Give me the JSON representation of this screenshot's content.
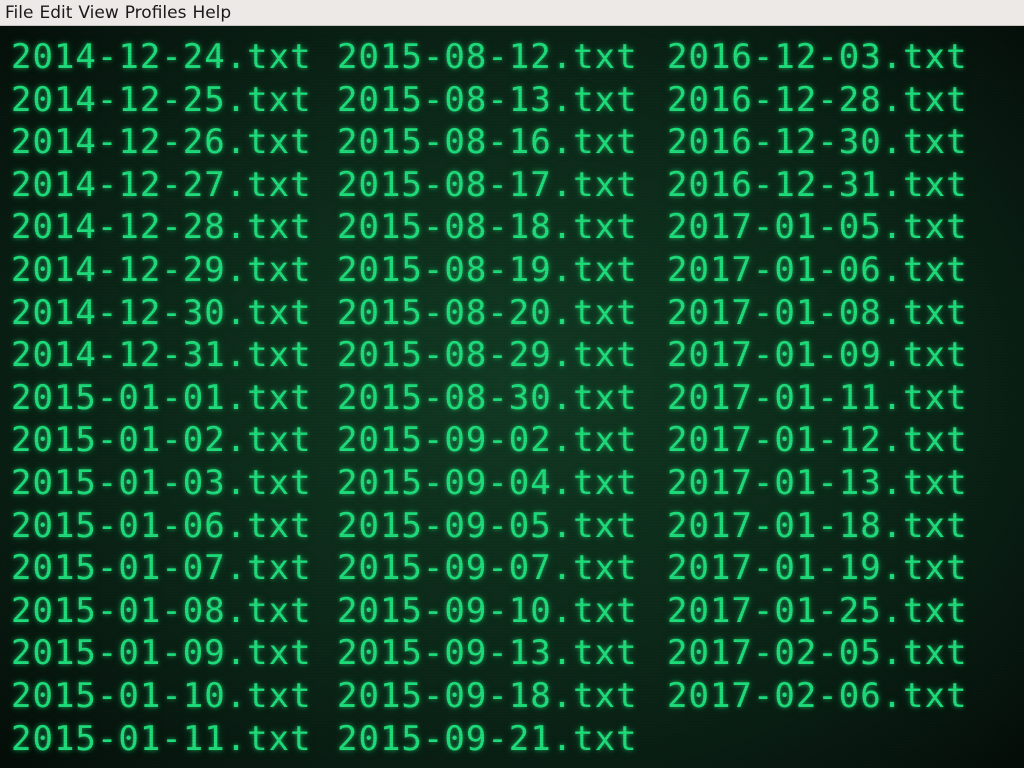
{
  "menubar": {
    "items": [
      {
        "label": "File"
      },
      {
        "label": "Edit"
      },
      {
        "label": "View"
      },
      {
        "label": "Profiles"
      },
      {
        "label": "Help"
      }
    ]
  },
  "terminal": {
    "text_color": "#1fdc7a",
    "background_color": "#0e2e1c",
    "columns": [
      {
        "files": [
          "2014-12-24.txt",
          "2014-12-25.txt",
          "2014-12-26.txt",
          "2014-12-27.txt",
          "2014-12-28.txt",
          "2014-12-29.txt",
          "2014-12-30.txt",
          "2014-12-31.txt",
          "2015-01-01.txt",
          "2015-01-02.txt",
          "2015-01-03.txt",
          "2015-01-06.txt",
          "2015-01-07.txt",
          "2015-01-08.txt",
          "2015-01-09.txt",
          "2015-01-10.txt",
          "2015-01-11.txt"
        ]
      },
      {
        "files": [
          "2015-08-12.txt",
          "2015-08-13.txt",
          "2015-08-16.txt",
          "2015-08-17.txt",
          "2015-08-18.txt",
          "2015-08-19.txt",
          "2015-08-20.txt",
          "2015-08-29.txt",
          "2015-08-30.txt",
          "2015-09-02.txt",
          "2015-09-04.txt",
          "2015-09-05.txt",
          "2015-09-07.txt",
          "2015-09-10.txt",
          "2015-09-13.txt",
          "2015-09-18.txt",
          "2015-09-21.txt"
        ]
      },
      {
        "files": [
          "2016-12-03.txt",
          "2016-12-28.txt",
          "2016-12-30.txt",
          "2016-12-31.txt",
          "2017-01-05.txt",
          "2017-01-06.txt",
          "2017-01-08.txt",
          "2017-01-09.txt",
          "2017-01-11.txt",
          "2017-01-12.txt",
          "2017-01-13.txt",
          "2017-01-18.txt",
          "2017-01-19.txt",
          "2017-01-25.txt",
          "2017-02-05.txt",
          "2017-02-06.txt"
        ]
      }
    ]
  }
}
